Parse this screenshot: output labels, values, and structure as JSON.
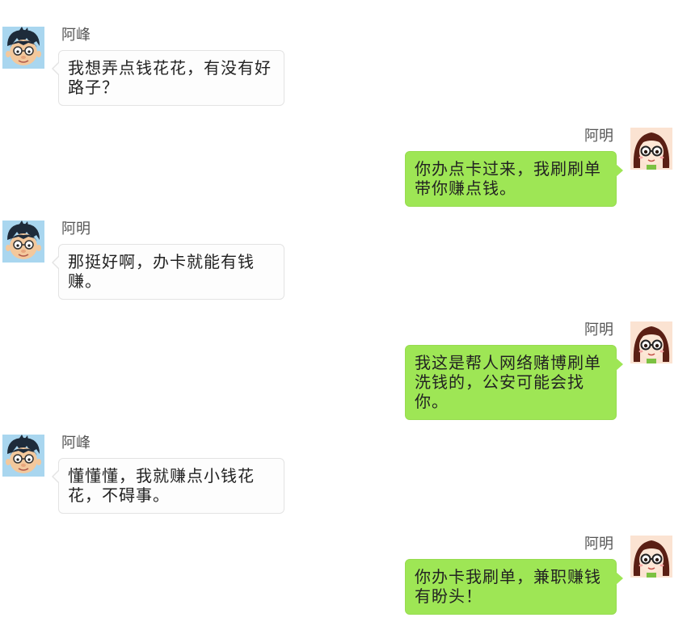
{
  "messages": [
    {
      "side": "left",
      "avatar": "boy-avatar",
      "name": "阿峰",
      "text": "我想弄点钱花花，有没有好路子？"
    },
    {
      "side": "right",
      "avatar": "girl-avatar",
      "name": "阿明",
      "text": "你办点卡过来，我刷刷单带你赚点钱。"
    },
    {
      "side": "left",
      "avatar": "boy-avatar",
      "name": "阿明",
      "text": "那挺好啊，办卡就能有钱赚。"
    },
    {
      "side": "right",
      "avatar": "girl-avatar",
      "name": "阿明",
      "text": "我这是帮人网络赌博刷单洗钱的，公安可能会找你。"
    },
    {
      "side": "left",
      "avatar": "boy-avatar",
      "name": "阿峰",
      "text": "懂懂懂，我就赚点小钱花花，不碍事。"
    },
    {
      "side": "right",
      "avatar": "girl-avatar",
      "name": "阿明",
      "text": "你办卡我刷单，兼职赚钱有盼头！"
    }
  ],
  "colors": {
    "left_bubble": "#fdfdfd",
    "left_border": "#e3e3e3",
    "right_bubble": "#9ee655",
    "name_text": "#555555",
    "message_text": "#222222"
  }
}
